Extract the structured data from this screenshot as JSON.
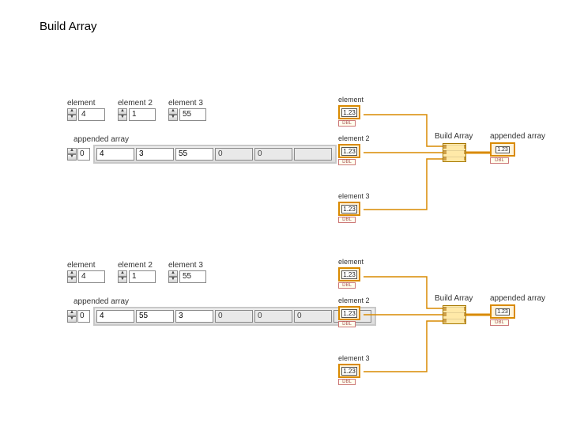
{
  "title": "Build Array",
  "example1": {
    "inputs": [
      {
        "label": "element",
        "value": "4"
      },
      {
        "label": "element 2",
        "value": "1"
      },
      {
        "label": "element 3",
        "value": "55"
      }
    ],
    "arrayLabel": "appended array",
    "arrayIndex": "0",
    "arrayCells": [
      "4",
      "3",
      "55",
      "0",
      "0",
      ""
    ],
    "filled": 3,
    "bd": {
      "terms": [
        {
          "label": "element",
          "num": "1.23",
          "tag": "DBL"
        },
        {
          "label": "element 2",
          "num": "1.23",
          "tag": "DBL"
        },
        {
          "label": "element 3",
          "num": "1.23",
          "tag": "DBL"
        }
      ],
      "buildLabel": "Build Array",
      "out": {
        "label": "appended array",
        "num": "1.23",
        "tag": "DBL"
      }
    }
  },
  "example2": {
    "inputs": [
      {
        "label": "element",
        "value": "4"
      },
      {
        "label": "element 2",
        "value": "1"
      },
      {
        "label": "element 3",
        "value": "55"
      }
    ],
    "arrayLabel": "appended array",
    "arrayIndex": "0",
    "arrayCells": [
      "4",
      "55",
      "3",
      "0",
      "0",
      "0",
      ""
    ],
    "filled": 3,
    "bd": {
      "terms": [
        {
          "label": "element",
          "num": "1.23",
          "tag": "DBL"
        },
        {
          "label": "element 2",
          "num": "1.23",
          "tag": "DBL"
        },
        {
          "label": "element 3",
          "num": "1.23",
          "tag": "DBL"
        }
      ],
      "buildLabel": "Build Array",
      "out": {
        "label": "appended array",
        "num": "1.23",
        "tag": "DBL"
      }
    }
  }
}
